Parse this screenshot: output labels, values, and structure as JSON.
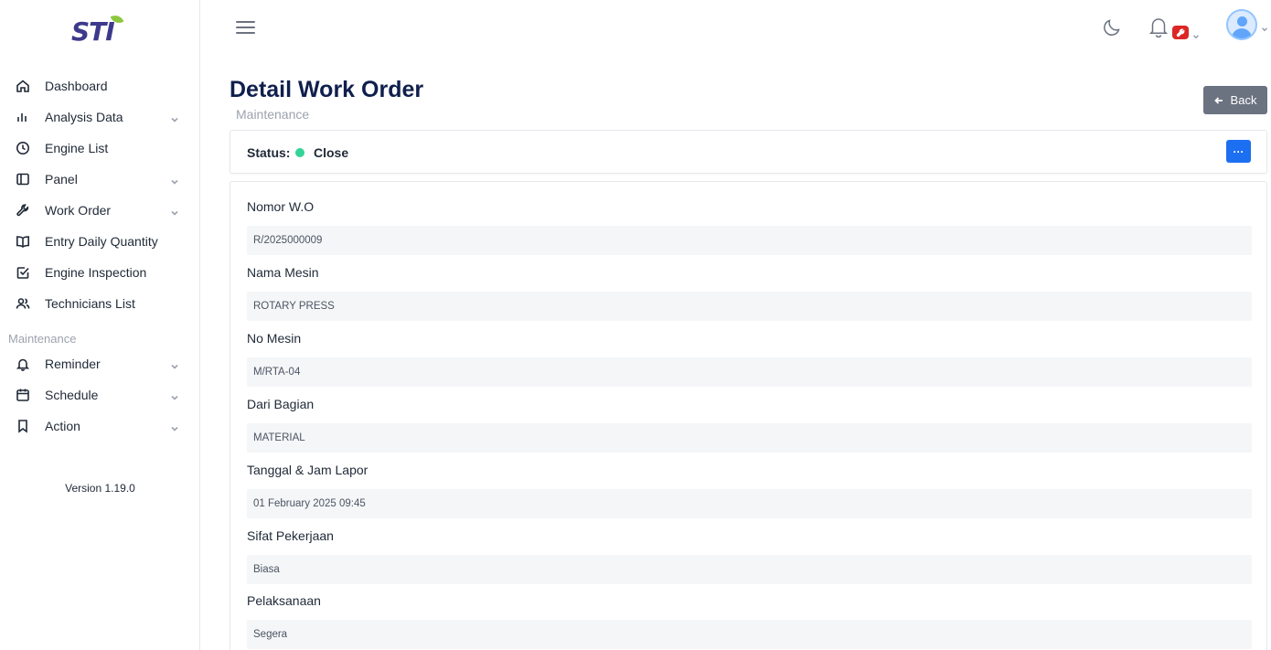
{
  "brand": {
    "logo_text": "STI"
  },
  "sidebar": {
    "items": [
      {
        "label": "Dashboard",
        "icon": "home-icon",
        "has_submenu": false
      },
      {
        "label": "Analysis Data",
        "icon": "bar-chart-icon",
        "has_submenu": true
      },
      {
        "label": "Engine List",
        "icon": "clock-icon",
        "has_submenu": false
      },
      {
        "label": "Panel",
        "icon": "panel-icon",
        "has_submenu": true
      },
      {
        "label": "Work Order",
        "icon": "wrench-icon",
        "has_submenu": true
      },
      {
        "label": "Entry Daily Quantity",
        "icon": "book-open-icon",
        "has_submenu": false
      },
      {
        "label": "Engine Inspection",
        "icon": "check-square-icon",
        "has_submenu": false
      },
      {
        "label": "Technicians List",
        "icon": "users-icon",
        "has_submenu": false
      }
    ],
    "section_title": "Maintenance",
    "maintenance_items": [
      {
        "label": "Reminder",
        "icon": "bell-icon",
        "has_submenu": true
      },
      {
        "label": "Schedule",
        "icon": "calendar-icon",
        "has_submenu": true
      },
      {
        "label": "Action",
        "icon": "bookmark-icon",
        "has_submenu": true
      }
    ],
    "version": "Version 1.19.0"
  },
  "header": {
    "title": "Detail Work Order",
    "subtitle": "Maintenance",
    "back_label": "Back"
  },
  "status": {
    "label": "Status:",
    "value": "Close",
    "color": "#34d399",
    "more_label": "···"
  },
  "fields": [
    {
      "label": "Nomor W.O",
      "value": "R/2025000009"
    },
    {
      "label": "Nama Mesin",
      "value": "ROTARY PRESS"
    },
    {
      "label": "No Mesin",
      "value": "M/RTA-04"
    },
    {
      "label": "Dari Bagian",
      "value": "MATERIAL"
    },
    {
      "label": "Tanggal & Jam Lapor",
      "value": "01 February 2025 09:45"
    },
    {
      "label": "Sifat Pekerjaan",
      "value": "Biasa"
    },
    {
      "label": "Pelaksanaan",
      "value": "Segera"
    }
  ],
  "colors": {
    "title": "#0f1f4d",
    "primary_button": "#1d6ff2",
    "back_button": "#6b7280",
    "badge": "#dc2626"
  }
}
